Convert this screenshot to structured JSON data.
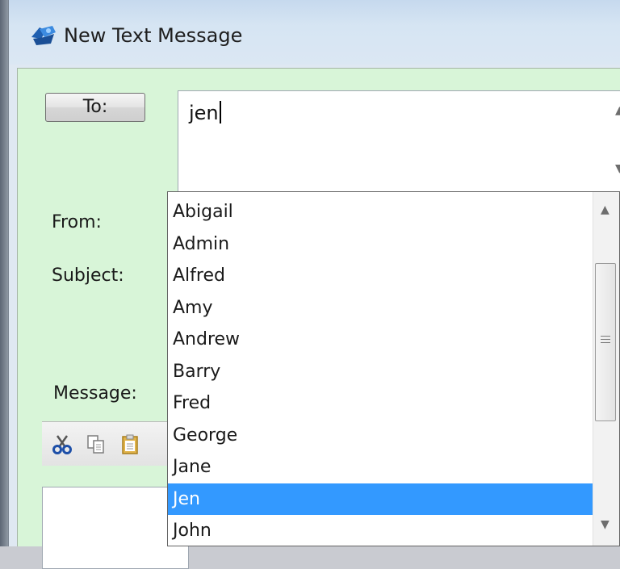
{
  "window": {
    "title": "New Text Message"
  },
  "form": {
    "to_button_label": "To:",
    "to_value": "jen",
    "from_label": "From:",
    "subject_label": "Subject:",
    "message_label": "Message:"
  },
  "autocomplete": {
    "items": [
      "Abigail",
      "Admin",
      "Alfred",
      "Amy",
      "Andrew",
      "Barry",
      "Fred",
      "George",
      "Jane",
      "Jen",
      "John"
    ],
    "selected": "Jen"
  },
  "toolbar": {
    "icons": [
      "cut-icon",
      "copy-icon",
      "paste-icon"
    ]
  },
  "colors": {
    "client_bg": "#d8f5d8",
    "selection": "#3399ff"
  }
}
